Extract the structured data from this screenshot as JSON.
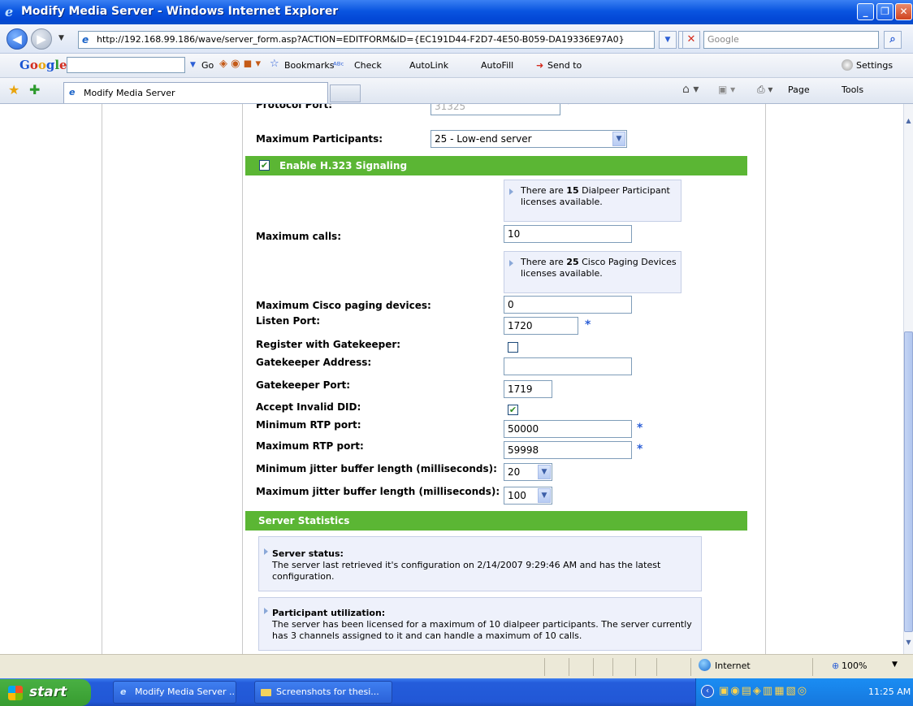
{
  "window": {
    "title": "Modify Media Server - Windows Internet Explorer"
  },
  "address": {
    "url": "http://192.168.99.186/wave/server_form.asp?ACTION=EDITFORM&ID={EC191D44-F2D7-4E50-B059-DA19336E97A0}",
    "search_placeholder": "Google"
  },
  "toolbar": {
    "google": "Google",
    "go": "Go",
    "bookmarks": "Bookmarks",
    "check": "Check",
    "autolink": "AutoLink",
    "autofill": "AutoFill",
    "sendto": "Send to",
    "settings": "Settings"
  },
  "tabs": {
    "active": "Modify Media Server"
  },
  "commandbar": {
    "page": "Page",
    "tools": "Tools"
  },
  "form": {
    "protocol_port_label": "Protocol Port:",
    "protocol_port_value": "31325",
    "max_participants_label": "Maximum Participants:",
    "max_participants_value": "25 - Low-end server",
    "h323_label": "Enable H.323 Signaling",
    "info1_pre": "There are ",
    "info1_num": "15",
    "info1_post": " Dialpeer Participant licenses available.",
    "max_calls_label": "Maximum calls:",
    "max_calls_value": "10",
    "info2_pre": "There are ",
    "info2_num": "25",
    "info2_post": " Cisco Paging Devices licenses available.",
    "max_paging_label": "Maximum Cisco paging devices:",
    "max_paging_value": "0",
    "listen_port_label": "Listen Port:",
    "listen_port_value": "1720",
    "register_gk_label": "Register with Gatekeeper:",
    "gk_address_label": "Gatekeeper Address:",
    "gk_address_value": "",
    "gk_port_label": "Gatekeeper Port:",
    "gk_port_value": "1719",
    "accept_did_label": "Accept Invalid DID:",
    "min_rtp_label": "Minimum RTP port:",
    "min_rtp_value": "50000",
    "max_rtp_label": "Maximum RTP port:",
    "max_rtp_value": "59998",
    "min_jitter_label": "Minimum jitter buffer length (milliseconds):",
    "min_jitter_value": "20",
    "max_jitter_label": "Maximum jitter buffer length (milliseconds):",
    "max_jitter_value": "100",
    "required_mark": "*",
    "check_mark": "✔"
  },
  "stats": {
    "header": "Server Statistics",
    "status_title": "Server status:",
    "status_text": "The server last retrieved it's configuration on 2/14/2007 9:29:46 AM and has the latest configuration.",
    "util_title": "Participant utilization:",
    "util_text": "The server has been licensed for a maximum of 10 dialpeer participants. The server currently has 3 channels assigned to it and can handle a maximum of 10 calls."
  },
  "statusbar": {
    "zone": "Internet",
    "zoom": "100%"
  },
  "taskbar": {
    "start": "start",
    "task1": "Modify Media Server ...",
    "task2": "Screenshots for thesi...",
    "clock": "11:25 AM"
  },
  "colors": {
    "green_bar": "#5bb634",
    "info_box": "#eef1fb",
    "title_bar": "#0347d6"
  }
}
